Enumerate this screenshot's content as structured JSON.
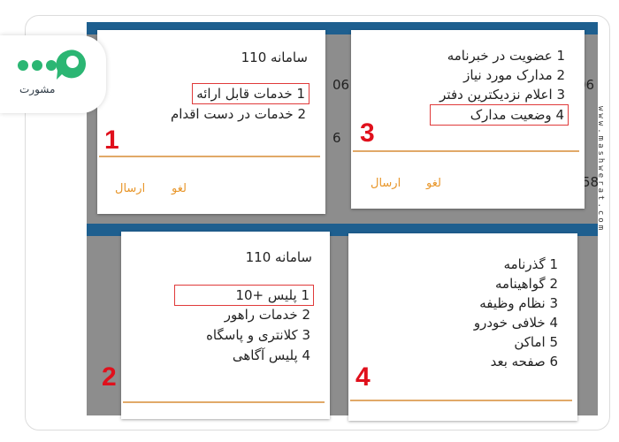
{
  "logo": {
    "text": "مشورت",
    "icon": "chat-bubble-logo-icon",
    "colors": [
      "#2bb673",
      "#1e5f8f"
    ]
  },
  "watermark": "www.mashwerat.com",
  "accent_color": "#e8962a",
  "highlight_color": "#e03a3a",
  "step_color": "#e0101c",
  "background_strip_text": [
    "06",
    "6",
    "06",
    "58",
    "06"
  ],
  "dialogs": {
    "d1": {
      "step": "1",
      "title": "سامانه 110",
      "items": [
        "1 خدمات قابل ارائه",
        "2 خدمات در دست اقدام"
      ],
      "cancel": "لغو",
      "send": "ارسال"
    },
    "d3": {
      "step": "3",
      "items": [
        "1 عضویت در خبرنامه",
        "2 مدارک مورد نیاز",
        "3 اعلام نزدیکترین دفتر",
        "4 وضعیت مدارک"
      ],
      "cancel": "لغو",
      "send": "ارسال"
    },
    "d2": {
      "step": "2",
      "title": "سامانه 110",
      "items": [
        "1 پلیس +10",
        "2 خدمات راهور",
        "3 کلانتری و پاسگاه",
        "4 پلیس آگاهی"
      ]
    },
    "d4": {
      "step": "4",
      "items": [
        "1 گذرنامه",
        "2 گواهینامه",
        "3 نظام وظیفه",
        "4 خلافی خودرو",
        "5 اماکن",
        "6 صفحه بعد"
      ]
    }
  }
}
